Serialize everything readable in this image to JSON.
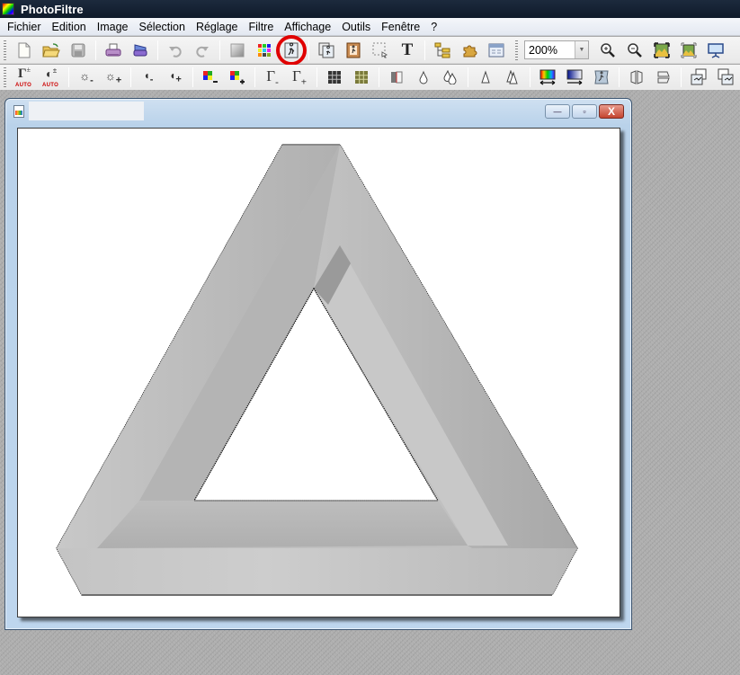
{
  "app": {
    "title": "PhotoFiltre"
  },
  "menubar": {
    "items": [
      {
        "label": "Fichier"
      },
      {
        "label": "Edition"
      },
      {
        "label": "Image"
      },
      {
        "label": "Sélection"
      },
      {
        "label": "Réglage"
      },
      {
        "label": "Filtre"
      },
      {
        "label": "Affichage"
      },
      {
        "label": "Outils"
      },
      {
        "label": "Fenêtre"
      },
      {
        "label": "?"
      }
    ]
  },
  "toolbar_main": {
    "buttons": [
      {
        "name": "new-file",
        "icon": "new-file-icon"
      },
      {
        "name": "open-file",
        "icon": "open-folder-icon"
      },
      {
        "name": "save-file",
        "icon": "floppy-disk-icon"
      },
      {
        "name": "print",
        "icon": "printer-icon"
      },
      {
        "name": "scan",
        "icon": "scanner-icon"
      },
      {
        "name": "undo",
        "icon": "undo-icon"
      },
      {
        "name": "redo",
        "icon": "redo-icon"
      },
      {
        "name": "gradient-fill",
        "icon": "gradient-square-icon"
      },
      {
        "name": "color-palette",
        "icon": "color-grid-icon"
      },
      {
        "name": "image-size",
        "icon": "image-size-icon",
        "highlighted": true
      },
      {
        "name": "canvas-size",
        "icon": "canvas-size-icon"
      },
      {
        "name": "frame",
        "icon": "frame-icon"
      },
      {
        "name": "selection-tool",
        "icon": "dashed-selection-icon"
      },
      {
        "name": "text-tool",
        "icon": "text-t-icon"
      },
      {
        "name": "explorer",
        "icon": "folder-tree-icon"
      },
      {
        "name": "plugins",
        "icon": "puzzle-icon"
      },
      {
        "name": "window-manager",
        "icon": "window-icon"
      }
    ],
    "zoom": {
      "value": "200%"
    },
    "zoom_buttons": [
      {
        "name": "zoom-in",
        "icon": "zoom-in-icon"
      },
      {
        "name": "zoom-out",
        "icon": "zoom-out-icon"
      },
      {
        "name": "actual-size",
        "icon": "actual-size-icon"
      },
      {
        "name": "fit-window",
        "icon": "fit-window-icon"
      },
      {
        "name": "fullscreen",
        "icon": "slideshow-icon"
      }
    ]
  },
  "toolbar_adjust": {
    "auto_label": "AUTO",
    "buttons": [
      {
        "name": "auto-levels",
        "icon": "gamma-auto-icon"
      },
      {
        "name": "auto-contrast",
        "icon": "contrast-auto-icon"
      },
      {
        "name": "brightness-minus",
        "icon": "sun-minus-icon"
      },
      {
        "name": "brightness-plus",
        "icon": "sun-plus-icon"
      },
      {
        "name": "contrast-minus",
        "icon": "contrast-minus-icon"
      },
      {
        "name": "contrast-plus",
        "icon": "contrast-plus-icon"
      },
      {
        "name": "saturation-minus",
        "icon": "color-minus-icon"
      },
      {
        "name": "saturation-plus",
        "icon": "color-plus-icon"
      },
      {
        "name": "gamma-minus",
        "icon": "gamma-minus-icon"
      },
      {
        "name": "gamma-plus",
        "icon": "gamma-plus-icon"
      },
      {
        "name": "grayscale",
        "icon": "grid-dark-icon"
      },
      {
        "name": "sepia",
        "icon": "grid-sepia-icon"
      },
      {
        "name": "soften",
        "icon": "soften-icon"
      },
      {
        "name": "blur",
        "icon": "drop-icon"
      },
      {
        "name": "blur-more",
        "icon": "double-drop-icon"
      },
      {
        "name": "sharpen",
        "icon": "triangle-icon"
      },
      {
        "name": "sharpen-more",
        "icon": "double-triangle-icon"
      },
      {
        "name": "rainbow-gradient",
        "icon": "rainbow-gradient-icon"
      },
      {
        "name": "color-gradient",
        "icon": "blue-gradient-icon"
      },
      {
        "name": "texture",
        "icon": "texture-icon"
      },
      {
        "name": "flip-horizontal",
        "icon": "flip-horizontal-icon"
      },
      {
        "name": "flip-vertical",
        "icon": "flip-vertical-icon"
      },
      {
        "name": "rotate-left",
        "icon": "rotate-left-icon"
      },
      {
        "name": "rotate-right",
        "icon": "rotate-right-icon"
      }
    ]
  },
  "document_window": {
    "title": "",
    "buttons": {
      "minimize": "—",
      "maximize": "▫",
      "close": "X"
    },
    "image": {
      "subject": "Penrose impossible triangle, grayscale"
    }
  },
  "colors": {
    "titlebar": "#13202f",
    "highlight_ring": "#e00000",
    "window_frame": "#bed6ee",
    "workspace": "#acacac"
  }
}
